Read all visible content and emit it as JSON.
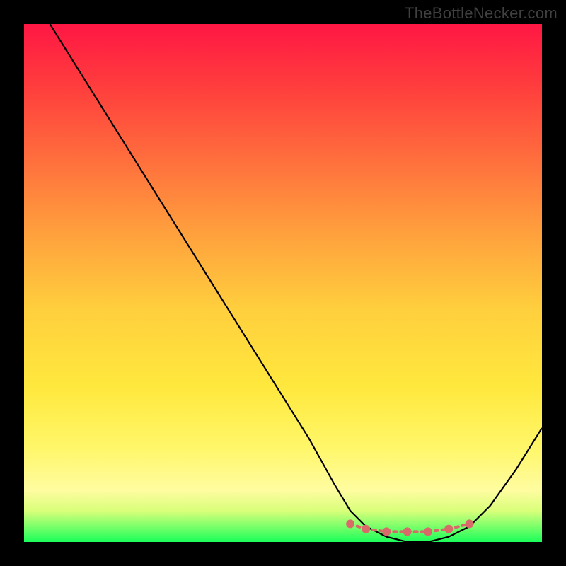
{
  "watermark": "TheBottleNecker.com",
  "chart_data": {
    "type": "line",
    "title": "",
    "xlabel": "",
    "ylabel": "",
    "xlim": [
      0,
      100
    ],
    "ylim": [
      0,
      100
    ],
    "series": [
      {
        "name": "bottleneck-curve",
        "x": [
          5,
          10,
          15,
          20,
          25,
          30,
          35,
          40,
          45,
          50,
          55,
          60,
          63,
          66,
          70,
          74,
          78,
          82,
          86,
          90,
          95,
          100
        ],
        "values": [
          100,
          92,
          84,
          76,
          68,
          60,
          52,
          44,
          36,
          28,
          20,
          11,
          6,
          3,
          1,
          0,
          0,
          1,
          3,
          7,
          14,
          22
        ]
      },
      {
        "name": "optimal-markers",
        "x": [
          63,
          66,
          70,
          74,
          78,
          82,
          86
        ],
        "values": [
          3.5,
          2.5,
          2,
          2,
          2,
          2.5,
          3.5
        ]
      }
    ],
    "gradient": {
      "stops": [
        {
          "offset": 0.0,
          "color": "#ff1744"
        },
        {
          "offset": 0.12,
          "color": "#ff3d3d"
        },
        {
          "offset": 0.25,
          "color": "#ff6a3d"
        },
        {
          "offset": 0.4,
          "color": "#ff9f3d"
        },
        {
          "offset": 0.55,
          "color": "#ffcf3d"
        },
        {
          "offset": 0.7,
          "color": "#ffe83d"
        },
        {
          "offset": 0.82,
          "color": "#fff76a"
        },
        {
          "offset": 0.9,
          "color": "#fffca0"
        },
        {
          "offset": 0.94,
          "color": "#d9ff7a"
        },
        {
          "offset": 0.97,
          "color": "#7bff6a"
        },
        {
          "offset": 1.0,
          "color": "#1aff5a"
        }
      ]
    },
    "marker_color": "#d86a6a"
  }
}
